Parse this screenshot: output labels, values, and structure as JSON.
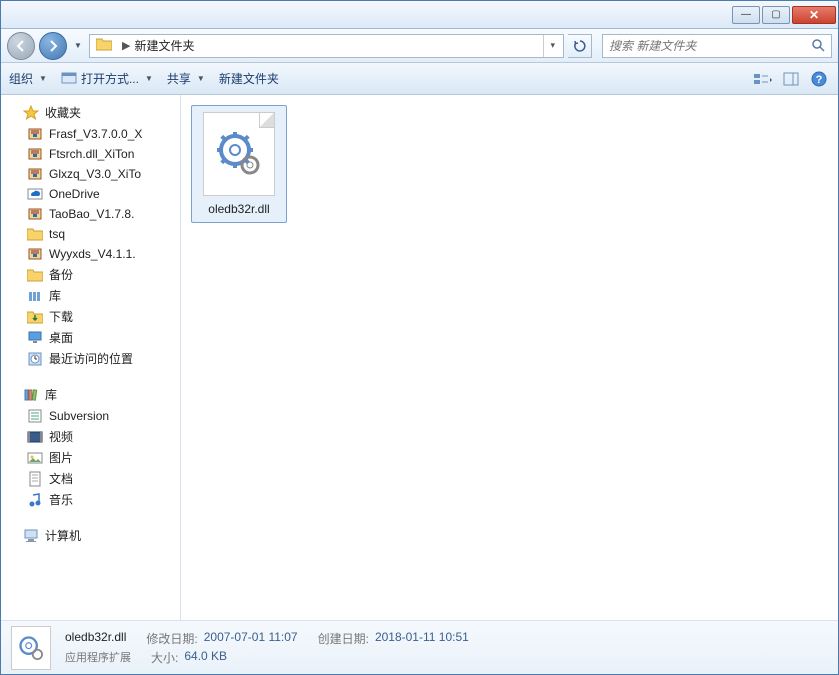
{
  "titlebar": {
    "minimize": "—",
    "maximize": "▢",
    "close": "✕"
  },
  "navbar": {
    "breadcrumb_sep": "▶",
    "breadcrumb_current": "新建文件夹",
    "search_placeholder": "搜索 新建文件夹"
  },
  "toolbar": {
    "organize": "组织",
    "open_with": "打开方式...",
    "share": "共享",
    "new_folder": "新建文件夹"
  },
  "sidebar": {
    "favorites": {
      "label": "收藏夹",
      "items": [
        {
          "label": "Frasf_V3.7.0.0_X",
          "type": "archive"
        },
        {
          "label": "Ftsrch.dll_XiTon",
          "type": "archive"
        },
        {
          "label": "Glxzq_V3.0_XiTo",
          "type": "archive"
        },
        {
          "label": "OneDrive",
          "type": "onedrive"
        },
        {
          "label": "TaoBao_V1.7.8.",
          "type": "archive"
        },
        {
          "label": "tsq",
          "type": "folder"
        },
        {
          "label": "Wyyxds_V4.1.1.",
          "type": "archive"
        },
        {
          "label": "备份",
          "type": "folder"
        },
        {
          "label": "库",
          "type": "library"
        },
        {
          "label": "下载",
          "type": "download"
        },
        {
          "label": "桌面",
          "type": "desktop"
        },
        {
          "label": "最近访问的位置",
          "type": "recent"
        }
      ]
    },
    "libraries": {
      "label": "库",
      "items": [
        {
          "label": "Subversion",
          "type": "svn"
        },
        {
          "label": "视频",
          "type": "video"
        },
        {
          "label": "图片",
          "type": "pictures"
        },
        {
          "label": "文档",
          "type": "documents"
        },
        {
          "label": "音乐",
          "type": "music"
        }
      ]
    },
    "computer": {
      "label": "计算机"
    }
  },
  "files": [
    {
      "name": "oledb32r.dll"
    }
  ],
  "details": {
    "name": "oledb32r.dll",
    "type": "应用程序扩展",
    "modified_label": "修改日期:",
    "modified": "2007-07-01 11:07",
    "size_label": "大小:",
    "size": "64.0 KB",
    "created_label": "创建日期:",
    "created": "2018-01-11 10:51"
  }
}
